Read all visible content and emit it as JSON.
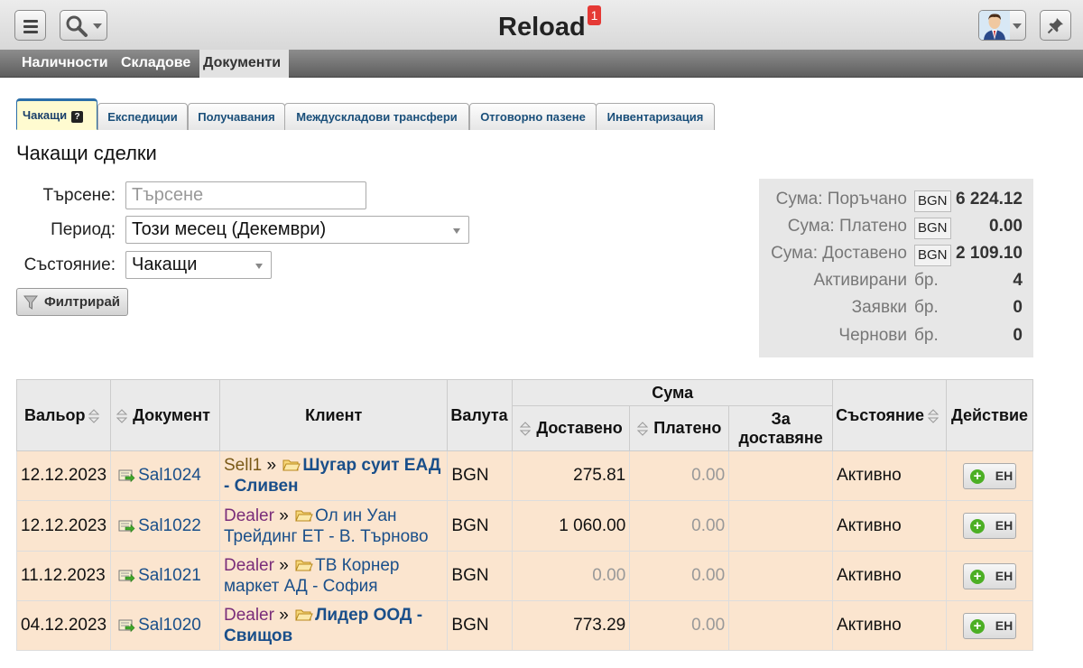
{
  "app": {
    "title": "Reload",
    "notification_count": "1"
  },
  "icons": {
    "menu": "hamburger-icon",
    "search": "magnifier-icon",
    "pin": "pin-icon",
    "filter": "funnel-icon",
    "add": "plus-circle-icon",
    "doc": "document-arrow-icon",
    "folder": "folder-icon"
  },
  "nav": {
    "items": [
      "Наличности",
      "Складове",
      "Документи"
    ],
    "active": "Документи"
  },
  "tabs": {
    "items": [
      "Чакащи",
      "Експедиции",
      "Получавания",
      "Междускладови трансфери",
      "Отговорно пазене",
      "Инвентаризация"
    ],
    "help": "?"
  },
  "page_title": "Чакащи сделки",
  "filters": {
    "search_label": "Търсене:",
    "search_placeholder": "Търсене",
    "period_label": "Период:",
    "period_value": "Този месец (Декември)",
    "state_label": "Състояние:",
    "state_value": "Чакащи",
    "filter_button": "Филтрирай"
  },
  "summary": {
    "rows": [
      {
        "label": "Сума: Поръчано",
        "unit": "BGN",
        "value": "6 224.12"
      },
      {
        "label": "Сума: Платено",
        "unit": "BGN",
        "value": "0.00"
      },
      {
        "label": "Сума: Доставено",
        "unit": "BGN",
        "value": "2 109.10"
      },
      {
        "label": "Активирани",
        "unit": "бр.",
        "value": "4"
      },
      {
        "label": "Заявки",
        "unit": "бр.",
        "value": "0"
      },
      {
        "label": "Чернови",
        "unit": "бр.",
        "value": "0"
      }
    ]
  },
  "table": {
    "headers": {
      "date": "Вальор",
      "document": "Документ",
      "client": "Клиент",
      "currency": "Валута",
      "amount": "Сума",
      "delivered": "Доставено",
      "paid": "Платено",
      "to_deliver": "За доставяне",
      "state": "Състояние",
      "action": "Действие"
    },
    "rows": [
      {
        "date": "12.12.2023",
        "doc": "Sal1024",
        "role": "Sell1",
        "client": "Шугар суит ЕАД - Сливен",
        "currency": "BGN",
        "delivered": "275.81",
        "paid": "0.00",
        "to_deliver": "",
        "state": "Активно",
        "action": "ЕН"
      },
      {
        "date": "12.12.2023",
        "doc": "Sal1022",
        "role": "Dealer",
        "client": "Ол ин Уан Трейдинг ЕТ - В. Търново",
        "currency": "BGN",
        "delivered": "1 060.00",
        "paid": "0.00",
        "to_deliver": "",
        "state": "Активно",
        "action": "ЕН"
      },
      {
        "date": "11.12.2023",
        "doc": "Sal1021",
        "role": "Dealer",
        "client": "ТВ Корнер маркет АД - София",
        "currency": "BGN",
        "delivered": "0.00",
        "paid": "0.00",
        "to_deliver": "",
        "state": "Активно",
        "action": "ЕН"
      },
      {
        "date": "04.12.2023",
        "doc": "Sal1020",
        "role": "Dealer",
        "client": "Лидер ООД - Свищов",
        "currency": "BGN",
        "delivered": "773.29",
        "paid": "0.00",
        "to_deliver": "",
        "state": "Активно",
        "action": "ЕН"
      }
    ]
  }
}
